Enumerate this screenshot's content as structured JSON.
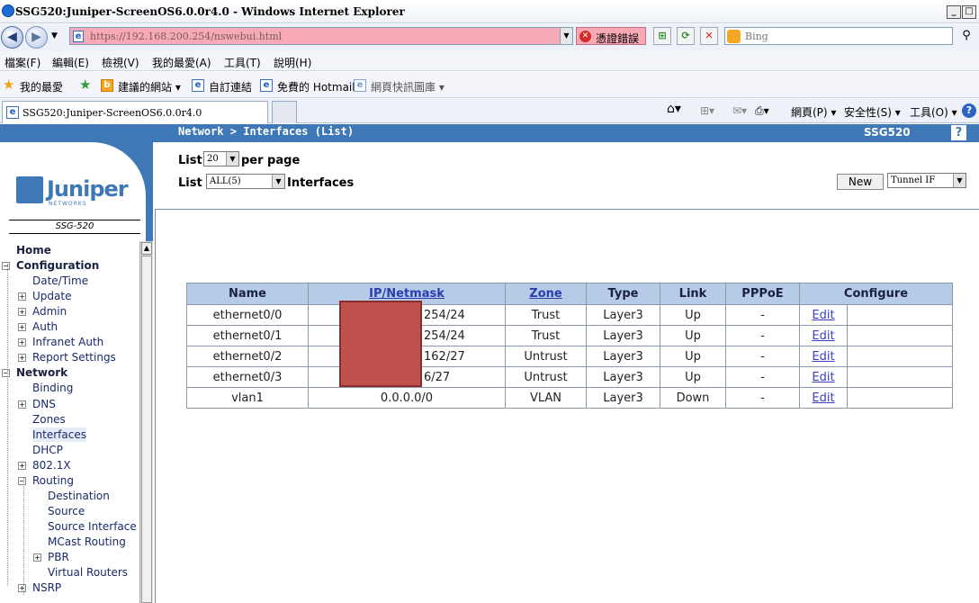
{
  "browser": {
    "title": "SSG520:Juniper-ScreenOS6.0.0r4.0 - Windows Internet Explorer",
    "window_buttons": [
      "_",
      "□",
      "X"
    ],
    "url": "https://192.168.200.254/nswebui.html",
    "cert_error": "憑證錯誤",
    "search_placeholder": "Bing",
    "menu": [
      "檔案(F)",
      "編輯(E)",
      "檢視(V)",
      "我的最愛(A)",
      "工具(T)",
      "說明(H)"
    ],
    "favorites": {
      "label": "我的最愛",
      "items": [
        "建議的網站 ▾",
        "自訂連結",
        "免費的 Hotmail",
        "網頁快訊圖庫 ▾"
      ]
    },
    "tab_title": "SSG520:Juniper-ScreenOS6.0.0r4.0",
    "commands": [
      "網頁(P) ▾",
      "安全性(S) ▾",
      "工具(O) ▾"
    ],
    "accent": "#3f78b6"
  },
  "app": {
    "breadcrumb": "Network > Interfaces (List)",
    "model": "SSG520",
    "help_label": "?",
    "logo": {
      "name": "Juniper",
      "sub": "NETWORKS",
      "device": "SSG-520"
    },
    "controls": {
      "list_label": "List",
      "per_page_value": "20",
      "per_page_label": "per page",
      "filter_value": "ALL(5)",
      "interfaces_label": "Interfaces",
      "new_button": "New",
      "type_value": "Tunnel IF"
    },
    "sidebar": [
      {
        "label": "Home",
        "bold": true
      },
      {
        "label": "Configuration",
        "bold": true,
        "toggle": "−"
      },
      {
        "label": "Date/Time"
      },
      {
        "label": "Update",
        "toggle": "+"
      },
      {
        "label": "Admin",
        "toggle": "+"
      },
      {
        "label": "Auth",
        "toggle": "+"
      },
      {
        "label": "Infranet Auth",
        "toggle": "+"
      },
      {
        "label": "Report Settings",
        "toggle": "+"
      },
      {
        "label": "Network",
        "bold": true,
        "toggle": "−"
      },
      {
        "label": "Binding"
      },
      {
        "label": "DNS",
        "toggle": "+"
      },
      {
        "label": "Zones"
      },
      {
        "label": "Interfaces",
        "selected": true
      },
      {
        "label": "DHCP"
      },
      {
        "label": "802.1X",
        "toggle": "+"
      },
      {
        "label": "Routing",
        "toggle": "−"
      },
      {
        "label": "Destination"
      },
      {
        "label": "Source"
      },
      {
        "label": "Source Interface"
      },
      {
        "label": "MCast Routing"
      },
      {
        "label": "PBR",
        "toggle": "+"
      },
      {
        "label": "Virtual Routers"
      },
      {
        "label": "NSRP",
        "toggle": "+"
      }
    ],
    "table": {
      "columns": [
        "Name",
        "IP/Netmask",
        "Zone",
        "Type",
        "Link",
        "PPPoE",
        "Configure"
      ],
      "rows": [
        {
          "name": "ethernet0/0",
          "ip": "254/24",
          "zone": "Trust",
          "type": "Layer3",
          "link": "Up",
          "pppoe": "-",
          "edit": "Edit"
        },
        {
          "name": "ethernet0/1",
          "ip": "254/24",
          "zone": "Trust",
          "type": "Layer3",
          "link": "Up",
          "pppoe": "-",
          "edit": "Edit"
        },
        {
          "name": "ethernet0/2",
          "ip": "162/27",
          "zone": "Untrust",
          "type": "Layer3",
          "link": "Up",
          "pppoe": "-",
          "edit": "Edit"
        },
        {
          "name": "ethernet0/3",
          "ip": "6/27",
          "zone": "Untrust",
          "type": "Layer3",
          "link": "Up",
          "pppoe": "-",
          "edit": "Edit"
        },
        {
          "name": "vlan1",
          "ip": "0.0.0.0/0",
          "zone": "VLAN",
          "type": "Layer3",
          "link": "Down",
          "pppoe": "-",
          "edit": "Edit"
        }
      ]
    }
  }
}
